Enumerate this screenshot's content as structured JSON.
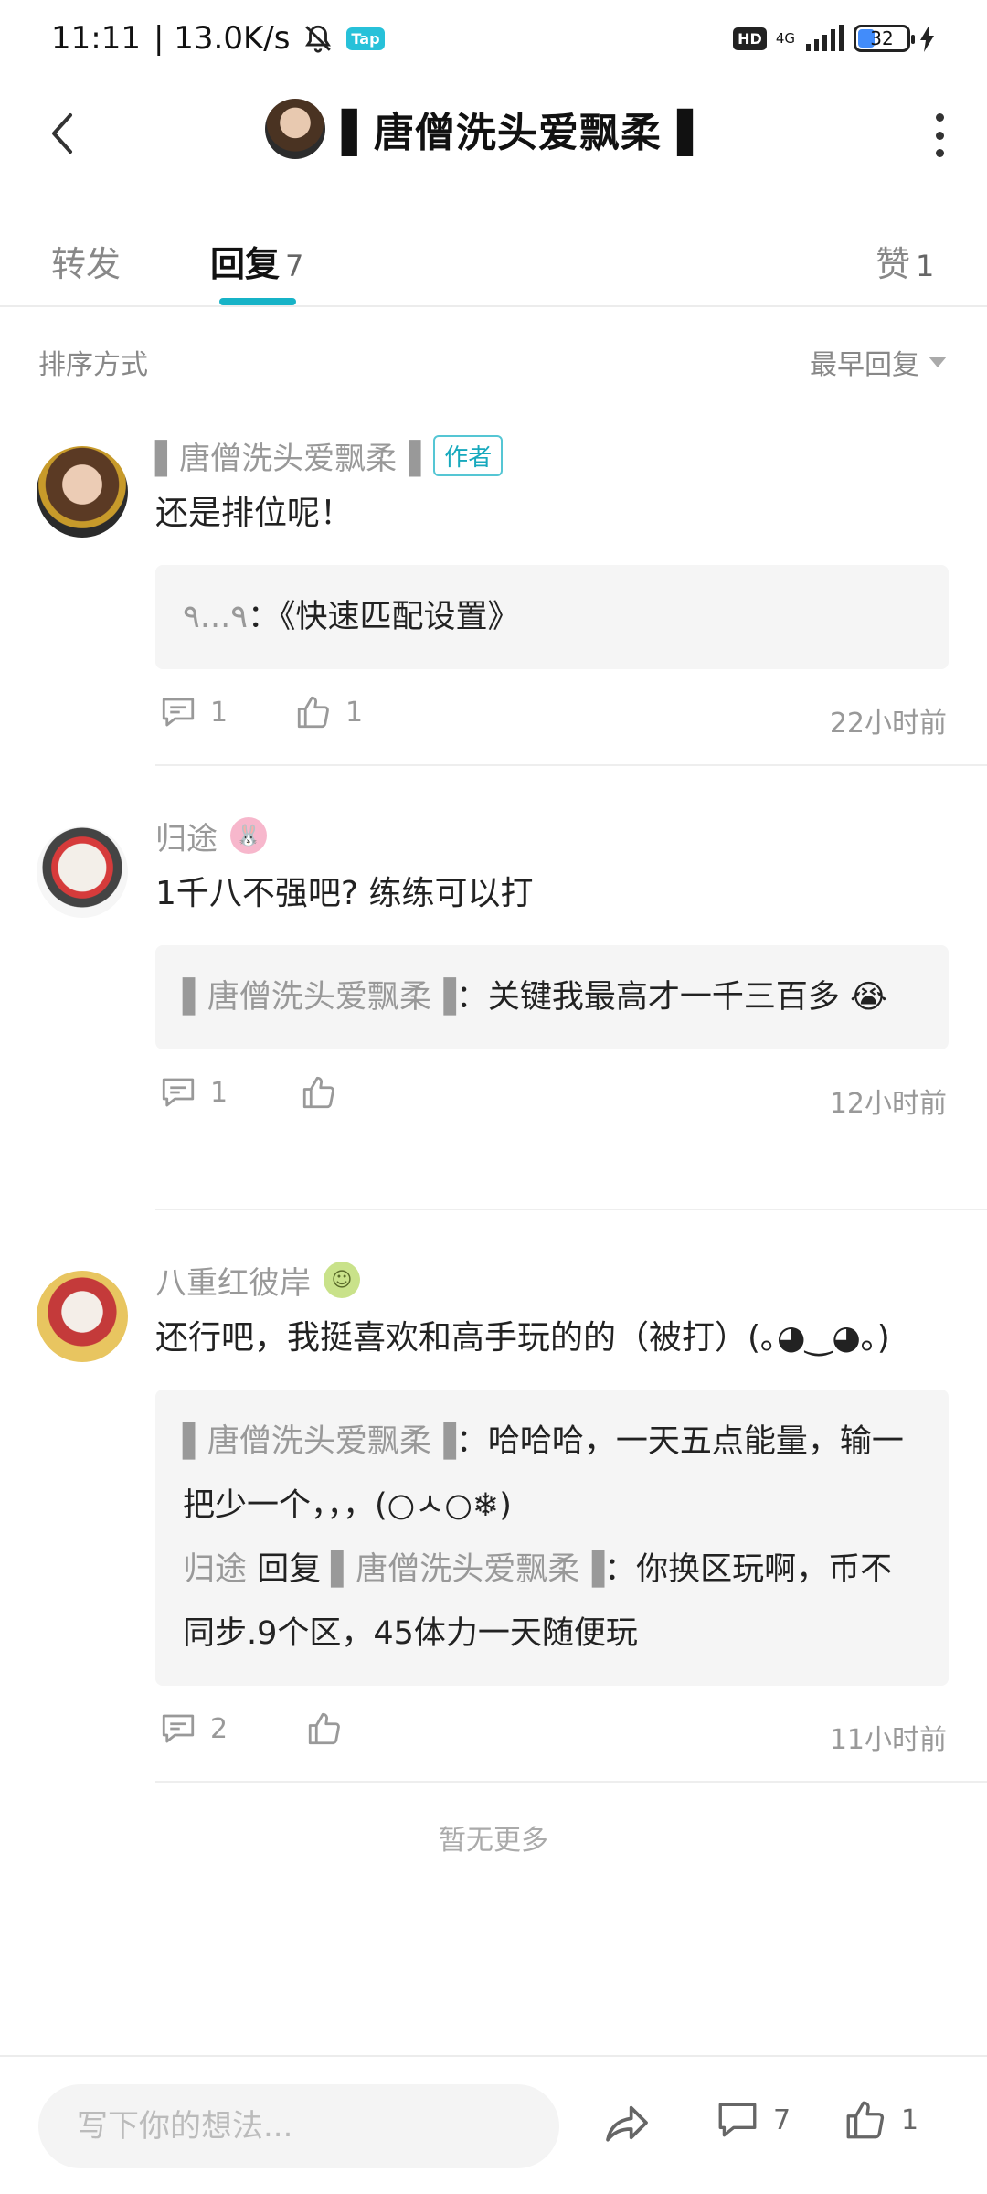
{
  "status_bar": {
    "time": "11:11",
    "speed": "13.0K/s",
    "tap_label": "Tap",
    "hd_label": "HD",
    "network": "4G",
    "battery": "32"
  },
  "header": {
    "title": "▌唐僧洗头爱飘柔▐"
  },
  "tabs": [
    {
      "label": "转发",
      "count": ""
    },
    {
      "label": "回复",
      "count": "7"
    },
    {
      "label": "赞",
      "count": "1"
    }
  ],
  "sort": {
    "label": "排序方式",
    "selected": "最早回复"
  },
  "comments": [
    {
      "name": "▌唐僧洗头爱飘柔▐",
      "badge": "作者",
      "text": "还是排位呢！",
      "quote": [
        {
          "name": "٩...٩",
          "text": "：《快速匹配设置》"
        }
      ],
      "reply_count": "1",
      "like_count": "1",
      "time": "22小时前"
    },
    {
      "name": "归途",
      "badge_icon": "rabbit-icon",
      "text": "1千八不强吧? 练练可以打",
      "quote": [
        {
          "name": "▌唐僧洗头爱飘柔▐",
          "text": "：关键我最高才一千三百多 😭"
        }
      ],
      "reply_count": "1",
      "like_count": "",
      "time": "12小时前"
    },
    {
      "name": "八重红彼岸",
      "badge_icon": "character-icon",
      "text": "还行吧，我挺喜欢和高手玩的的（被打）(｡◕‿◕｡)",
      "quote": [
        {
          "name": "▌唐僧洗头爱飘柔▐",
          "text": "：哈哈哈，一天五点能量，输一把少一个，，，(○ㅅ○❄)"
        },
        {
          "name": "归途",
          "reply_word": " 回复 ",
          "reply_to": "▌唐僧洗头爱飘柔▐",
          "text": "：你换区玩啊，币不同步.9个区，45体力一天随便玩"
        }
      ],
      "reply_count": "2",
      "like_count": "",
      "time": "11小时前"
    }
  ],
  "no_more": "暂无更多",
  "bottom_bar": {
    "placeholder": "写下你的想法...",
    "comment_count": "7",
    "like_count": "1"
  },
  "colors": {
    "accent": "#17b3c7",
    "muted": "#999999",
    "quote_bg": "#f5f5f5"
  }
}
